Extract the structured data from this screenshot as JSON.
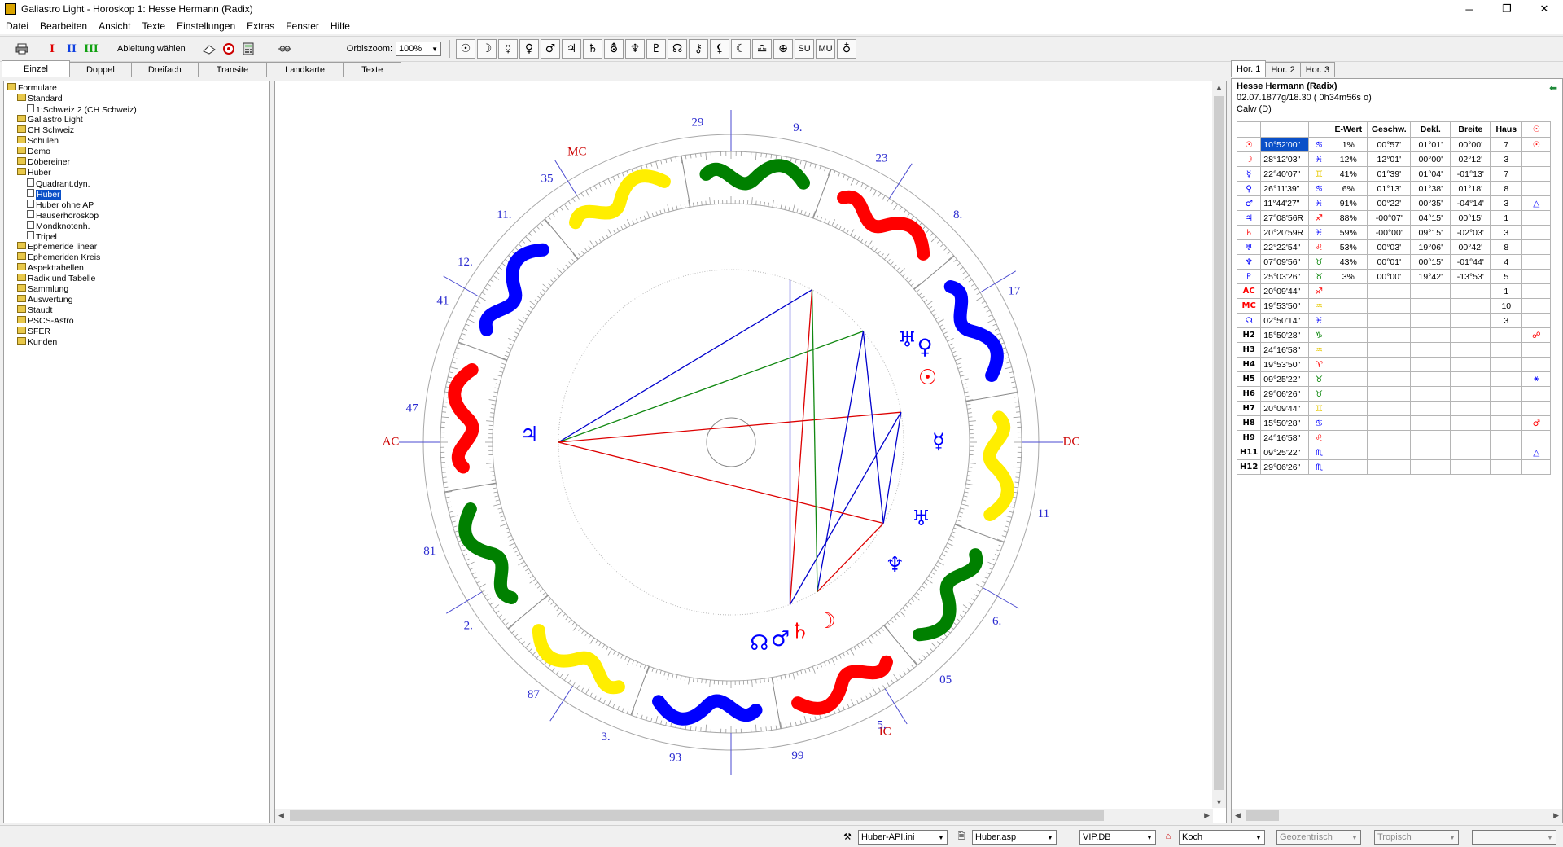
{
  "window": {
    "title": "Galiastro Light - Horoskop 1: Hesse Hermann (Radix)",
    "controls": [
      "─",
      "❐",
      "✕"
    ]
  },
  "menu": [
    "Datei",
    "Bearbeiten",
    "Ansicht",
    "Texte",
    "Einstellungen",
    "Extras",
    "Fenster",
    "Hilfe"
  ],
  "toolbar": {
    "levels": [
      "I",
      "II",
      "III"
    ],
    "ableitung_label": "Ableitung wählen",
    "orbiszoom_label": "Orbiszoom:",
    "orbiszoom_value": "100%",
    "symbols": [
      "☉",
      "☽",
      "☿",
      "♀",
      "♂",
      "♃",
      "♄",
      "⛢",
      "♆",
      "♇",
      "☊",
      "⚷",
      "⚸",
      "☾",
      "♎",
      "⊕",
      "SU",
      "MU",
      "♁"
    ]
  },
  "left_tabs": [
    "Einzel",
    "Doppel",
    "Dreifach",
    "Transite",
    "Landkarte",
    "Texte"
  ],
  "tree": [
    {
      "label": "Formulare",
      "level": 0,
      "type": "folder"
    },
    {
      "label": "Standard",
      "level": 1,
      "type": "folder"
    },
    {
      "label": "1:Schweiz 2 (CH Schweiz)",
      "level": 2,
      "type": "doc"
    },
    {
      "label": "Galiastro Light",
      "level": 1,
      "type": "folder"
    },
    {
      "label": "CH Schweiz",
      "level": 1,
      "type": "folder"
    },
    {
      "label": "Schulen",
      "level": 1,
      "type": "folder"
    },
    {
      "label": "Demo",
      "level": 1,
      "type": "folder"
    },
    {
      "label": "Döbereiner",
      "level": 1,
      "type": "folder"
    },
    {
      "label": "Huber",
      "level": 1,
      "type": "folder"
    },
    {
      "label": "Quadrant.dyn.",
      "level": 2,
      "type": "doc"
    },
    {
      "label": "Huber",
      "level": 2,
      "type": "doc",
      "selected": true
    },
    {
      "label": "Huber ohne AP",
      "level": 2,
      "type": "doc"
    },
    {
      "label": "Häuserhoroskop",
      "level": 2,
      "type": "doc"
    },
    {
      "label": "Mondknotenh.",
      "level": 2,
      "type": "doc"
    },
    {
      "label": "Tripel",
      "level": 2,
      "type": "doc"
    },
    {
      "label": "Ephemeride linear",
      "level": 1,
      "type": "folder"
    },
    {
      "label": "Ephemeriden Kreis",
      "level": 1,
      "type": "folder"
    },
    {
      "label": "Aspekttabellen",
      "level": 1,
      "type": "folder"
    },
    {
      "label": "Radix und Tabelle",
      "level": 1,
      "type": "folder"
    },
    {
      "label": "Sammlung",
      "level": 1,
      "type": "folder"
    },
    {
      "label": "Auswertung",
      "level": 1,
      "type": "folder"
    },
    {
      "label": "Staudt",
      "level": 1,
      "type": "folder"
    },
    {
      "label": "PSCS-Astro",
      "level": 1,
      "type": "folder"
    },
    {
      "label": "SFER",
      "level": 1,
      "type": "folder"
    },
    {
      "label": "Kunden",
      "level": 1,
      "type": "folder"
    }
  ],
  "chart": {
    "angle_labels": {
      "ac": "AC",
      "dc": "DC",
      "mc": "MC",
      "ic": "IC"
    },
    "house_numbers": [
      "29",
      "9.",
      "23",
      "8.",
      "17",
      "DC",
      "11",
      "6.",
      "05",
      "5.",
      "99",
      "IC",
      "93",
      "3.",
      "87",
      "2.",
      "81",
      "47",
      "41",
      "12.",
      "11.",
      "35",
      "MC"
    ],
    "colors": {
      "fire": "#ff0000",
      "earth": "#008000",
      "air": "#ffee00",
      "water": "#0000ff",
      "aspect_blue": "#0000cc",
      "aspect_red": "#dd0000",
      "aspect_green": "#118811"
    },
    "planet_glyphs": [
      {
        "glyph": "♅",
        "color": "#0000ff"
      },
      {
        "glyph": "♀",
        "color": "#0000ff"
      },
      {
        "glyph": "☉",
        "color": "#ff0000"
      },
      {
        "glyph": "☿",
        "color": "#0000ff"
      },
      {
        "glyph": "♅",
        "color": "#0000ff"
      },
      {
        "glyph": "♆",
        "color": "#0000ff"
      },
      {
        "glyph": "☽",
        "color": "#ff0000"
      },
      {
        "glyph": "♄",
        "color": "#ff0000"
      },
      {
        "glyph": "♂",
        "color": "#0000ff"
      },
      {
        "glyph": "☊",
        "color": "#0000ff"
      },
      {
        "glyph": "♃",
        "color": "#0000ff"
      }
    ],
    "retro_mark": "R"
  },
  "right_tabs": [
    "Hor. 1",
    "Hor. 2",
    "Hor. 3"
  ],
  "horoscope": {
    "name": "Hesse Hermann (Radix)",
    "datetime": "02.07.1877g/18.30 ( 0h34m56s o)",
    "place": "Calw (D)"
  },
  "table": {
    "headers": [
      "",
      "",
      "",
      "E-Wert",
      "Geschw.",
      "Dekl.",
      "Breite",
      "Haus",
      "☉"
    ],
    "rows": [
      {
        "sym": "☉",
        "symcolor": "#ff0000",
        "pos": "10°52'00\"",
        "sign": "♋",
        "signcolor": "#0000ff",
        "ew": "1%",
        "g": "00°57'",
        "d": "01°01'",
        "b": "00°00'",
        "h": "7",
        "a": "☉",
        "acolor": "#ff0000",
        "selected": true
      },
      {
        "sym": "☽",
        "symcolor": "#ff0000",
        "pos": "28°12'03\"",
        "sign": "♓",
        "signcolor": "#0000ff",
        "ew": "12%",
        "g": "12°01'",
        "d": "00°00'",
        "b": "02°12'",
        "h": "3",
        "a": "",
        "acolor": ""
      },
      {
        "sym": "☿",
        "symcolor": "#0000ff",
        "pos": "22°40'07\"",
        "sign": "♊",
        "signcolor": "#e6c800",
        "ew": "41%",
        "g": "01°39'",
        "d": "01°04'",
        "b": "-01°13'",
        "h": "7",
        "a": "",
        "acolor": ""
      },
      {
        "sym": "♀",
        "symcolor": "#0000ff",
        "pos": "26°11'39\"",
        "sign": "♋",
        "signcolor": "#0000ff",
        "ew": "6%",
        "g": "01°13'",
        "d": "01°38'",
        "b": "01°18'",
        "h": "8",
        "a": "",
        "acolor": ""
      },
      {
        "sym": "♂",
        "symcolor": "#0000ff",
        "pos": "11°44'27\"",
        "sign": "♓",
        "signcolor": "#0000ff",
        "ew": "91%",
        "g": "00°22'",
        "d": "00°35'",
        "b": "-04°14'",
        "h": "3",
        "a": "△",
        "acolor": "#0000ff"
      },
      {
        "sym": "♃",
        "symcolor": "#0000ff",
        "pos": "27°08'56R",
        "sign": "♐",
        "signcolor": "#ff0000",
        "ew": "88%",
        "g": "-00°07'",
        "d": "04°15'",
        "b": "00°15'",
        "h": "1",
        "a": "",
        "acolor": ""
      },
      {
        "sym": "♄",
        "symcolor": "#ff0000",
        "pos": "20°20'59R",
        "sign": "♓",
        "signcolor": "#0000ff",
        "ew": "59%",
        "g": "-00°00'",
        "d": "09°15'",
        "b": "-02°03'",
        "h": "3",
        "a": "",
        "acolor": ""
      },
      {
        "sym": "♅",
        "symcolor": "#0000ff",
        "pos": "22°22'54\"",
        "sign": "♌",
        "signcolor": "#ff0000",
        "ew": "53%",
        "g": "00°03'",
        "d": "19°06'",
        "b": "00°42'",
        "h": "8",
        "a": "",
        "acolor": ""
      },
      {
        "sym": "♆",
        "symcolor": "#0000ff",
        "pos": "07°09'56\"",
        "sign": "♉",
        "signcolor": "#008000",
        "ew": "43%",
        "g": "00°01'",
        "d": "00°15'",
        "b": "-01°44'",
        "h": "4",
        "a": "",
        "acolor": ""
      },
      {
        "sym": "♇",
        "symcolor": "#0000ff",
        "pos": "25°03'26\"",
        "sign": "♉",
        "signcolor": "#008000",
        "ew": "3%",
        "g": "00°00'",
        "d": "19°42'",
        "b": "-13°53'",
        "h": "5",
        "a": "",
        "acolor": ""
      },
      {
        "sym": "AC",
        "symcolor": "#ff0000",
        "pos": "20°09'44\"",
        "sign": "♐",
        "signcolor": "#ff0000",
        "ew": "",
        "g": "",
        "d": "",
        "b": "",
        "h": "1",
        "a": "",
        "acolor": ""
      },
      {
        "sym": "MC",
        "symcolor": "#ff0000",
        "pos": "19°53'50\"",
        "sign": "♒",
        "signcolor": "#e6c800",
        "ew": "",
        "g": "",
        "d": "",
        "b": "",
        "h": "10",
        "a": "",
        "acolor": ""
      },
      {
        "sym": "☊",
        "symcolor": "#0000ff",
        "pos": "02°50'14\"",
        "sign": "♓",
        "signcolor": "#0000ff",
        "ew": "",
        "g": "",
        "d": "",
        "b": "",
        "h": "3",
        "a": "",
        "acolor": ""
      },
      {
        "sym": "H2",
        "symcolor": "#000000",
        "pos": "15°50'28\"",
        "sign": "♑",
        "signcolor": "#008000",
        "ew": "",
        "g": "",
        "d": "",
        "b": "",
        "h": "",
        "a": "☍",
        "acolor": "#ff0000"
      },
      {
        "sym": "H3",
        "symcolor": "#000000",
        "pos": "24°16'58\"",
        "sign": "♒",
        "signcolor": "#e6c800",
        "ew": "",
        "g": "",
        "d": "",
        "b": "",
        "h": "",
        "a": "",
        "acolor": ""
      },
      {
        "sym": "H4",
        "symcolor": "#000000",
        "pos": "19°53'50\"",
        "sign": "♈",
        "signcolor": "#ff0000",
        "ew": "",
        "g": "",
        "d": "",
        "b": "",
        "h": "",
        "a": "",
        "acolor": ""
      },
      {
        "sym": "H5",
        "symcolor": "#000000",
        "pos": "09°25'22\"",
        "sign": "♉",
        "signcolor": "#008000",
        "ew": "",
        "g": "",
        "d": "",
        "b": "",
        "h": "",
        "a": "⚹",
        "acolor": "#0000ff"
      },
      {
        "sym": "H6",
        "symcolor": "#000000",
        "pos": "29°06'26\"",
        "sign": "♉",
        "signcolor": "#008000",
        "ew": "",
        "g": "",
        "d": "",
        "b": "",
        "h": "",
        "a": "",
        "acolor": ""
      },
      {
        "sym": "H7",
        "symcolor": "#000000",
        "pos": "20°09'44\"",
        "sign": "♊",
        "signcolor": "#e6c800",
        "ew": "",
        "g": "",
        "d": "",
        "b": "",
        "h": "",
        "a": "",
        "acolor": ""
      },
      {
        "sym": "H8",
        "symcolor": "#000000",
        "pos": "15°50'28\"",
        "sign": "♋",
        "signcolor": "#0000ff",
        "ew": "",
        "g": "",
        "d": "",
        "b": "",
        "h": "",
        "a": "♂",
        "acolor": "#ff0000"
      },
      {
        "sym": "H9",
        "symcolor": "#000000",
        "pos": "24°16'58\"",
        "sign": "♌",
        "signcolor": "#ff0000",
        "ew": "",
        "g": "",
        "d": "",
        "b": "",
        "h": "",
        "a": "",
        "acolor": ""
      },
      {
        "sym": "H11",
        "symcolor": "#000000",
        "pos": "09°25'22\"",
        "sign": "♏",
        "signcolor": "#0000ff",
        "ew": "",
        "g": "",
        "d": "",
        "b": "",
        "h": "",
        "a": "△",
        "acolor": "#0000ff"
      },
      {
        "sym": "H12",
        "symcolor": "#000000",
        "pos": "29°06'26\"",
        "sign": "♏",
        "signcolor": "#0000ff",
        "ew": "",
        "g": "",
        "d": "",
        "b": "",
        "h": "",
        "a": "",
        "acolor": ""
      }
    ]
  },
  "status": {
    "api_file": "Huber-API.ini",
    "asp_file": "Huber.asp",
    "db": "VIP.DB",
    "house_system": "Koch",
    "center": "Geozentrisch",
    "zodiac": "Tropisch",
    "extra": ""
  }
}
